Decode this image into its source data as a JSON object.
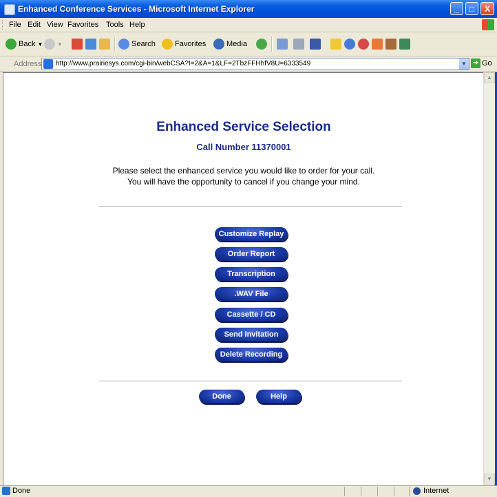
{
  "window": {
    "title": "Enhanced Conference Services - Microsoft Internet Explorer",
    "minimize": "_",
    "maximize": "□",
    "close": "X"
  },
  "menu": [
    "File",
    "Edit",
    "View",
    "Favorites",
    "Tools",
    "Help"
  ],
  "toolbar": {
    "back": "Back",
    "search": "Search",
    "favorites": "Favorites",
    "media": "Media"
  },
  "address": {
    "label": "Address",
    "url": "http://www.prairiesys.com/cgi-bin/webCSA?I=2&A=1&LF=2TbzFFHhfV8U=6333549",
    "go": "Go"
  },
  "page": {
    "heading": "Enhanced Service Selection",
    "call_number": "Call Number 11370001",
    "instructions_line1": "Please select the enhanced service you would like to order for your call.",
    "instructions_line2": "You will have the opportunity to cancel if you change your mind.",
    "services": [
      "Customize Replay",
      "Order Report",
      "Transcription",
      ".WAV File",
      "Cassette / CD",
      "Send Invitation",
      "Delete Recording"
    ],
    "done": "Done",
    "help": "Help"
  },
  "status": {
    "text": "Done",
    "zone": "Internet"
  },
  "colors": {
    "heading": "#1a2a8a",
    "button": "#1a3aa8"
  }
}
